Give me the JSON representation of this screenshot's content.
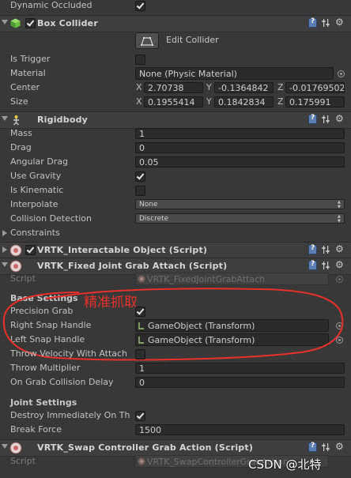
{
  "dynamic_occluded": {
    "label": "Dynamic Occluded",
    "checked": true
  },
  "box_collider": {
    "title": "Box Collider",
    "edit_label": "Edit Collider",
    "is_trigger_label": "Is Trigger",
    "material_label": "Material",
    "material_value": "None (Physic Material)",
    "center_label": "Center",
    "center": {
      "x": "2.70738",
      "y": "-0.1364842",
      "z": "-0.01769502"
    },
    "size_label": "Size",
    "size": {
      "x": "0.1955414",
      "y": "0.1842834",
      "z": "0.175991"
    },
    "axis_x": "X",
    "axis_y": "Y",
    "axis_z": "Z"
  },
  "rigidbody": {
    "title": "Rigidbody",
    "mass_label": "Mass",
    "mass": "1",
    "drag_label": "Drag",
    "drag": "0",
    "angular_drag_label": "Angular Drag",
    "angular_drag": "0.05",
    "use_gravity_label": "Use Gravity",
    "is_kinematic_label": "Is Kinematic",
    "interpolate_label": "Interpolate",
    "interpolate": "None",
    "collision_label": "Collision Detection",
    "collision": "Discrete",
    "constraints_label": "Constraints"
  },
  "interactable": {
    "title": "VRTK_Interactable Object (Script)"
  },
  "fixed_joint": {
    "title": "VRTK_Fixed Joint Grab Attach (Script)",
    "script_label": "Script",
    "script_value": "VRTK_FixedJointGrabAttach",
    "base_settings": "Base Settings",
    "annotation": "精准抓取",
    "precision_grab_label": "Precision Grab",
    "right_snap_label": "Right Snap Handle",
    "right_snap_value": "GameObject (Transform)",
    "left_snap_label": "Left Snap Handle",
    "left_snap_value": "GameObject (Transform)",
    "throw_velocity_label": "Throw Velocity With Attach",
    "throw_multiplier_label": "Throw Multiplier",
    "throw_multiplier": "1",
    "on_grab_delay_label": "On Grab Collision Delay",
    "on_grab_delay": "0",
    "joint_settings": "Joint Settings",
    "destroy_label": "Destroy Immediately On Th",
    "break_force_label": "Break Force",
    "break_force": "1500"
  },
  "swap": {
    "title": "VRTK_Swap Controller Grab Action (Script)",
    "script_label": "Script",
    "script_value": "VRTK_SwapControllerGrabAction"
  },
  "watermark": "CSDN @北特",
  "colors": {
    "annotation_red": "#e8302a",
    "book_blue": "#5c7fb3"
  }
}
